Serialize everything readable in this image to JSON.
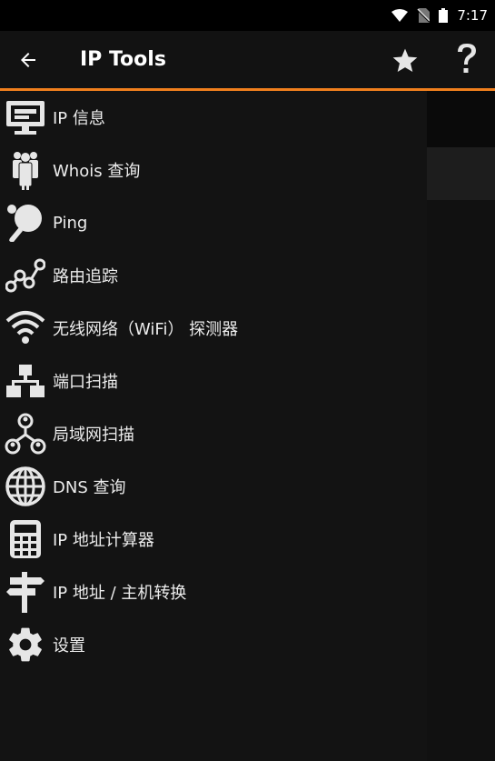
{
  "status": {
    "time": "7:17"
  },
  "toolbar": {
    "title": "IP Tools"
  },
  "menu": [
    {
      "label": "IP 信息",
      "icon": "monitor-icon"
    },
    {
      "label": "Whois 查询",
      "icon": "people-icon"
    },
    {
      "label": "Ping",
      "icon": "ping-pong-icon"
    },
    {
      "label": "路由追踪",
      "icon": "route-icon"
    },
    {
      "label": "无线网络（WiFi） 探测器",
      "icon": "wifi-icon"
    },
    {
      "label": "端口扫描",
      "icon": "network-blocks-icon"
    },
    {
      "label": "局域网扫描",
      "icon": "lan-nodes-icon"
    },
    {
      "label": "DNS 查询",
      "icon": "globe-icon"
    },
    {
      "label": "IP 地址计算器",
      "icon": "calculator-icon"
    },
    {
      "label": "IP 地址 / 主机转换",
      "icon": "signpost-icon"
    },
    {
      "label": "设置",
      "icon": "gear-icon"
    }
  ],
  "colors": {
    "accent": "#f07f1d",
    "icon": "#e6e6e6"
  }
}
